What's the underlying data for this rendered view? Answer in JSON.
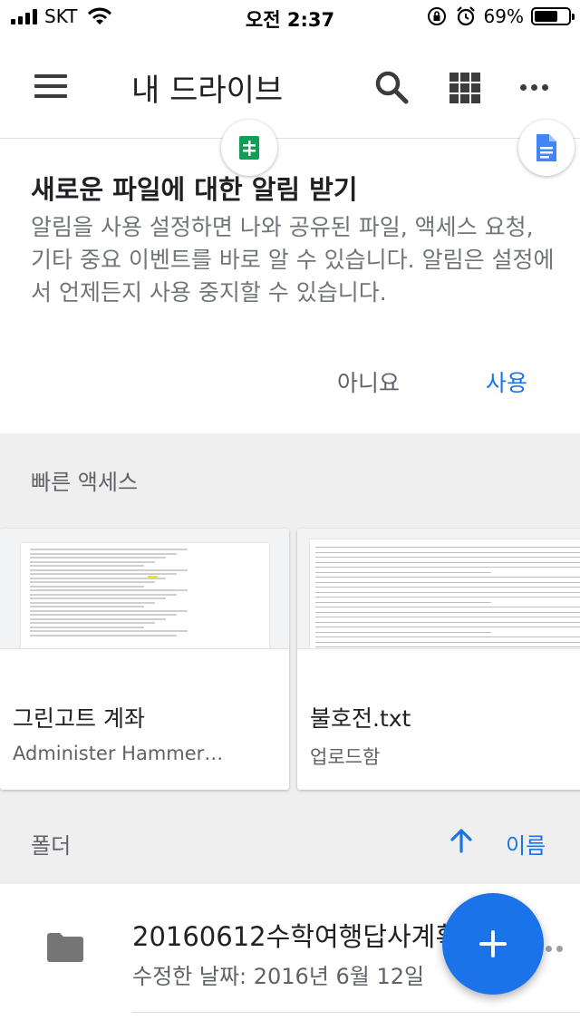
{
  "status_bar": {
    "carrier": "SKT",
    "time": "오전 2:37",
    "battery_percent": "69%",
    "battery_level": 0.69
  },
  "app_bar": {
    "title": "내 드라이브",
    "menu_icon": "menu-icon",
    "search_icon": "search-icon",
    "grid_icon": "grid-view-icon",
    "more_icon": "more-icon"
  },
  "notification": {
    "title": "새로운 파일에 대한 알림 받기",
    "body": "알림을 사용 설정하면 나와 공유된 파일, 액세스 요청, 기타 중요 이벤트를 바로 알 수 있습니다. 알림은 설정에서 언제든지 사용 중지할 수 있습니다.",
    "decline_label": "아니요",
    "accept_label": "사용"
  },
  "quick_access": {
    "header": "빠른 액세스",
    "items": [
      {
        "name": "그린고트 계좌",
        "subtitle": "Administer Hammer…",
        "type_icon": "google-sheets-icon"
      },
      {
        "name": "불호전.txt",
        "subtitle": "업로드함",
        "type_icon": "google-docs-icon"
      }
    ]
  },
  "folders": {
    "header": "폴더",
    "sort_icon": "arrow-up-icon",
    "sort_label": "이름",
    "items": [
      {
        "name": "20160612수학여행답사계획",
        "modified": "수정한 날짜: 2016년 6월 12일",
        "icon": "folder-icon"
      }
    ]
  },
  "fab": {
    "icon": "plus-icon"
  },
  "colors": {
    "accent": "#1a73e8",
    "sheets_green": "#0f9d58",
    "docs_blue": "#4285f4",
    "section_background": "#efefef"
  }
}
